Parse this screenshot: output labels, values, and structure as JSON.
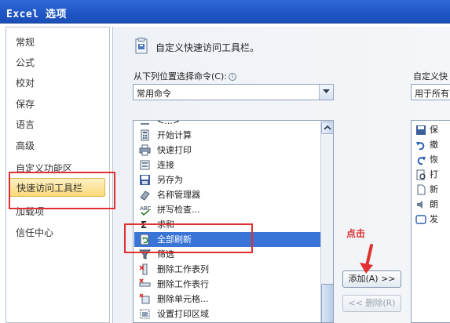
{
  "window": {
    "title": "Excel 选项"
  },
  "sidebar": {
    "items": [
      {
        "label": "常规"
      },
      {
        "label": "公式"
      },
      {
        "label": "校对"
      },
      {
        "label": "保存"
      },
      {
        "label": "语言"
      },
      {
        "label": "高级"
      },
      {
        "label": "自定义功能区"
      },
      {
        "label": "快速访问工具栏",
        "active": true
      },
      {
        "label": "加载项"
      },
      {
        "label": "信任中心"
      }
    ]
  },
  "main": {
    "title": "自定义快速访问工具栏。",
    "choose_label": "从下列位置选择命令(C):",
    "choose_value": "常用命令",
    "customize_label": "自定义快",
    "customize_value": "用于所有",
    "commands": [
      {
        "label": "<...>",
        "icon": "separator-icon"
      },
      {
        "label": "开始计算",
        "icon": "calculator-icon"
      },
      {
        "label": "快速打印",
        "icon": "quick-print-icon"
      },
      {
        "label": "连接",
        "icon": "connections-icon"
      },
      {
        "label": "另存为",
        "icon": "save-as-icon"
      },
      {
        "label": "名称管理器",
        "icon": "name-manager-icon"
      },
      {
        "label": "拼写检查...",
        "icon": "spelling-icon"
      },
      {
        "label": "求和",
        "icon": "sum-icon"
      },
      {
        "label": "全部刷新",
        "icon": "refresh-all-icon",
        "selected": true
      },
      {
        "label": "筛选",
        "icon": "filter-icon"
      },
      {
        "label": "删除工作表列",
        "icon": "delete-column-icon"
      },
      {
        "label": "删除工作表行",
        "icon": "delete-row-icon"
      },
      {
        "label": "删除单元格...",
        "icon": "delete-cells-icon"
      },
      {
        "label": "设置打印区域",
        "icon": "print-area-icon"
      }
    ],
    "toolbar_commands": [
      {
        "label": "保",
        "icon": "save-icon"
      },
      {
        "label": "撤",
        "icon": "undo-icon"
      },
      {
        "label": "恢",
        "icon": "redo-icon"
      },
      {
        "label": "打",
        "icon": "print-preview-icon"
      },
      {
        "label": "新",
        "icon": "new-icon"
      },
      {
        "label": "朗",
        "icon": "speak-icon"
      },
      {
        "label": "发",
        "icon": "send-icon"
      }
    ],
    "add_button": "添加(A) >>",
    "remove_button": "<< 删除(R)"
  },
  "annotation": {
    "text": "点击",
    "color": "#e03030"
  }
}
